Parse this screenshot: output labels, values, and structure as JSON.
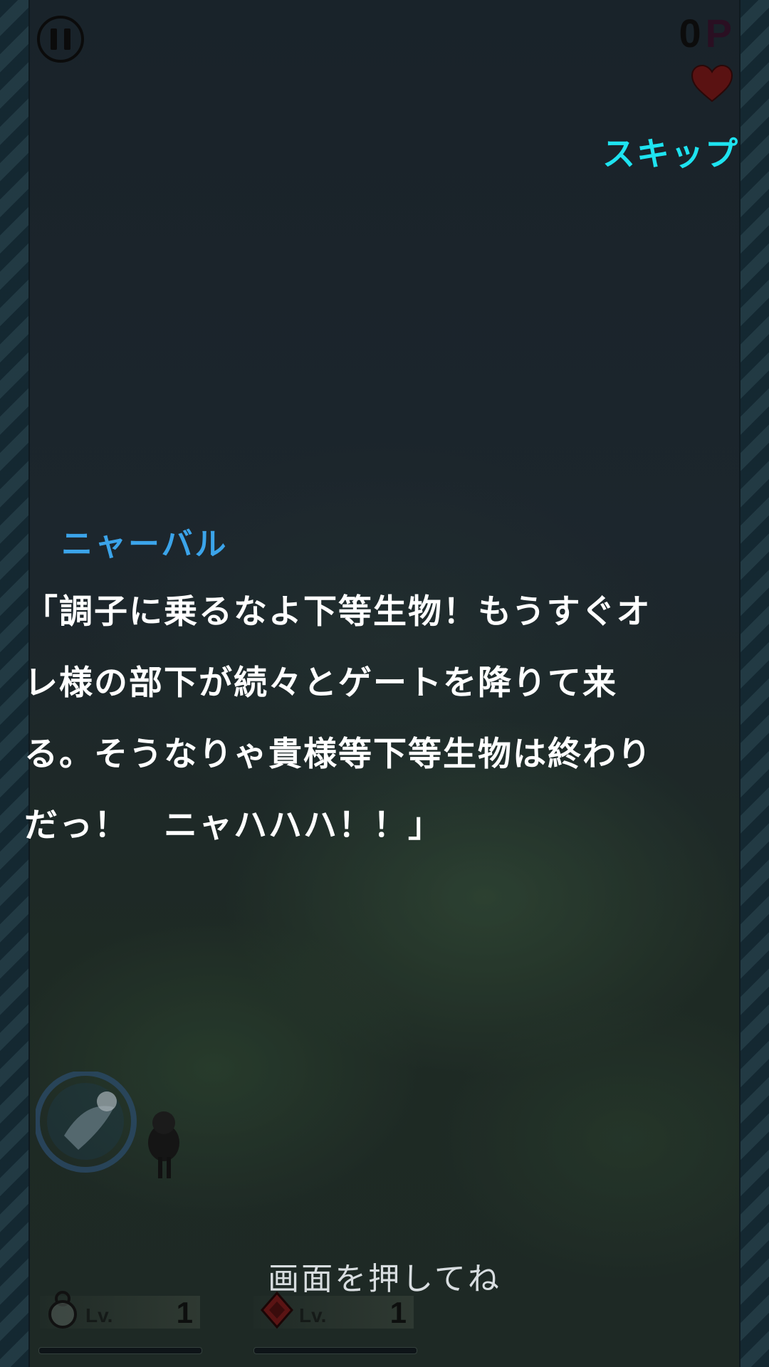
{
  "hud": {
    "score_value": "0",
    "score_unit": "P",
    "lives": 1,
    "skip_label": "スキップ"
  },
  "dialogue": {
    "speaker": "ニャーバル",
    "lines": [
      "「調子に乗るなよ下等生物！もうすぐオ",
      "レ様の部下が続々とゲートを降りて来",
      "る。そうなりゃ貴様等下等生物は終わり",
      "だっ！　ニャハハハ！！」"
    ]
  },
  "prompt": "画面を押してね",
  "levels": [
    {
      "icon": "character-icon",
      "label": "Lv.",
      "value": "1"
    },
    {
      "icon": "gem-icon",
      "label": "Lv.",
      "value": "1"
    }
  ],
  "colors": {
    "skip": "#1ee3f0",
    "speaker": "#3ba4ea",
    "heart": "#5a1212"
  }
}
